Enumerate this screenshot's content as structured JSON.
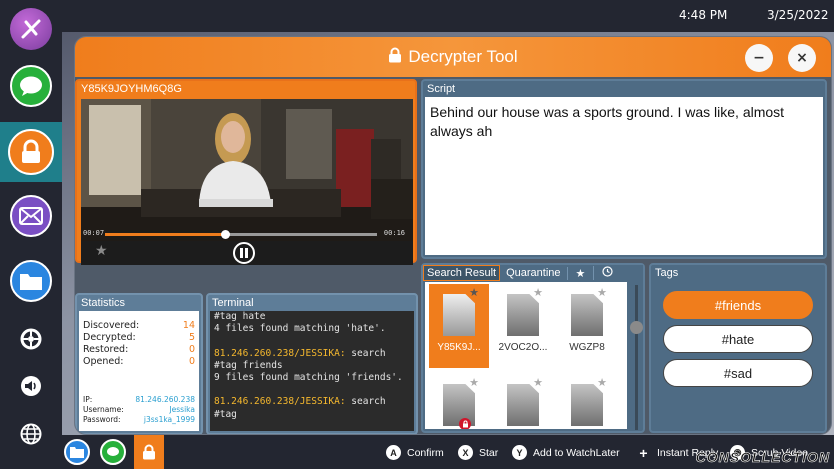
{
  "status_bar": {
    "time": "4:48 PM",
    "date": "3/25/2022"
  },
  "dock": {
    "apps": [
      "app-logo-icon",
      "messages-icon",
      "decrypter-lock-icon",
      "mail-icon",
      "files-folder-icon"
    ],
    "system": [
      "settings-icon",
      "volume-icon",
      "globe-icon"
    ]
  },
  "window": {
    "title": "Decrypter Tool",
    "minimize": "−",
    "close": "×"
  },
  "video": {
    "id": "Y85K9JOYHM6Q8G",
    "time_current": "00:07",
    "time_total": "00:16",
    "progress": 0.44
  },
  "script": {
    "label": "Script",
    "text": "Behind our house was a sports ground. I was like, almost always ah"
  },
  "statistics": {
    "label": "Statistics",
    "rows": [
      {
        "key": "Discovered:",
        "value": "14"
      },
      {
        "key": "Decrypted:",
        "value": "5"
      },
      {
        "key": "Restored:",
        "value": "0"
      },
      {
        "key": "Opened:",
        "value": "0"
      }
    ],
    "user": [
      {
        "key": "IP:",
        "value": "81.246.260.238"
      },
      {
        "key": "Username:",
        "value": "Jessika"
      },
      {
        "key": "Password:",
        "value": "j3ss1ka_1999"
      }
    ]
  },
  "terminal": {
    "label": "Terminal",
    "lines": [
      {
        "text": "#tag hate",
        "type": "out"
      },
      {
        "text": "4 files found matching 'hate'.",
        "type": "out"
      },
      {
        "text": "",
        "type": "out"
      },
      {
        "prompt": "81.246.260.238/JESSIKA:",
        "text": " search",
        "type": "cmd"
      },
      {
        "text": "#tag friends",
        "type": "out"
      },
      {
        "text": "9 files found matching 'friends'.",
        "type": "out"
      },
      {
        "text": "",
        "type": "out"
      },
      {
        "prompt": "81.246.260.238/JESSIKA:",
        "text": " search",
        "type": "cmd"
      },
      {
        "text": "#tag",
        "type": "out"
      }
    ]
  },
  "search": {
    "tabs": [
      "Search Result",
      "Quarantine"
    ],
    "files": [
      {
        "name": "Y85K9J...",
        "selected": true,
        "starred": true,
        "locked": false
      },
      {
        "name": "2VOC2O...",
        "selected": false,
        "starred": false,
        "locked": false
      },
      {
        "name": "WGZP8",
        "selected": false,
        "starred": false,
        "locked": false
      },
      {
        "name": "",
        "selected": false,
        "starred": false,
        "locked": true
      },
      {
        "name": "",
        "selected": false,
        "starred": false,
        "locked": false
      },
      {
        "name": "",
        "selected": false,
        "starred": false,
        "locked": false
      }
    ]
  },
  "tags": {
    "label": "Tags",
    "items": [
      "#friends",
      "#hate",
      "#sad"
    ],
    "active": "#friends"
  },
  "legend": [
    {
      "glyph": "A",
      "label": "Confirm"
    },
    {
      "glyph": "X",
      "label": "Star"
    },
    {
      "glyph": "Y",
      "label": "Add to WatchLater"
    },
    {
      "glyph": "+",
      "label": "Instant Reply"
    },
    {
      "glyph": "◉",
      "label": "Scrub Video"
    }
  ],
  "watermark": "CONSOLLECTION",
  "colors": {
    "accent": "#f07d1c",
    "panel": "#4e6b84",
    "dock": "#232631"
  }
}
